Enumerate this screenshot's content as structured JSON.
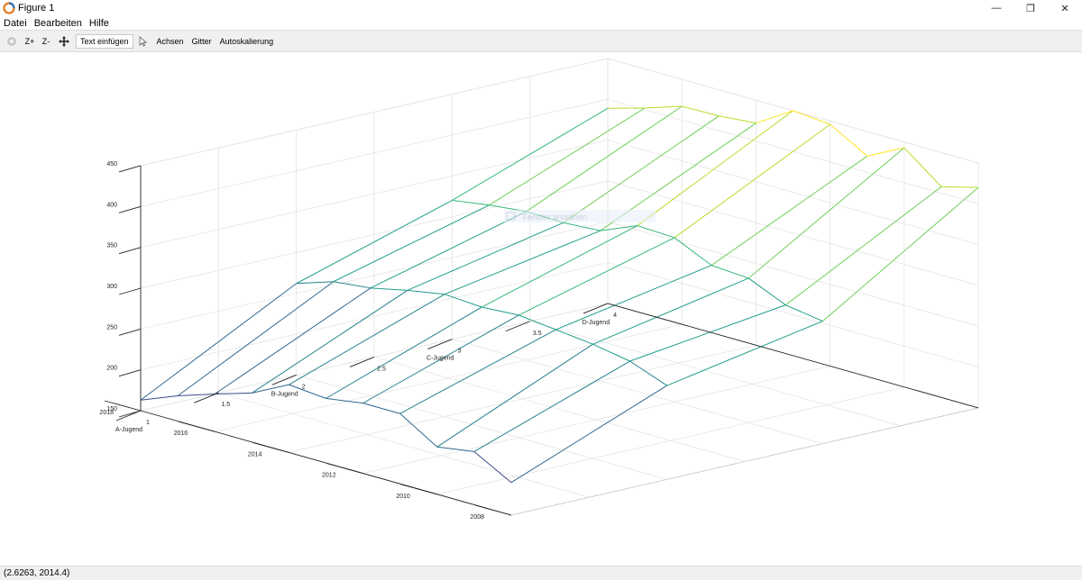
{
  "window": {
    "title": "Figure 1",
    "controls": {
      "minimize": "—",
      "restore": "❐",
      "close": "✕"
    }
  },
  "menu": {
    "items": [
      "Datei",
      "Bearbeiten",
      "Hilfe"
    ]
  },
  "toolbar": {
    "zoom_in": "Z+",
    "zoom_out": "Z-",
    "text_insert": "Text einfügen",
    "axes": "Achsen",
    "grid": "Gitter",
    "autoscale": "Autoskalierung",
    "icons": [
      "rotate-icon",
      "pan-icon",
      "select-arrow-icon"
    ]
  },
  "overlay": {
    "text": "Fenster anordnen"
  },
  "status": {
    "coords": "(2.6263, 2014.4)"
  },
  "chart_data": {
    "type": "surface-mesh",
    "title": "",
    "xlabel": "",
    "ylabel": "",
    "zlabel": "",
    "x_ticks": [
      "1",
      "1.5",
      "2",
      "2.5",
      "3",
      "3.5",
      "4"
    ],
    "x_category_labels": [
      "A-Jugend",
      "B-Jugend",
      "C-Jugend",
      "D-Jugend"
    ],
    "y_ticks": [
      "2008",
      "2010",
      "2012",
      "2014",
      "2016",
      "2018"
    ],
    "z_ticks": [
      "150",
      "200",
      "250",
      "300",
      "350",
      "400",
      "450"
    ],
    "xlim": [
      1,
      4
    ],
    "ylim": [
      2008,
      2018
    ],
    "zlim": [
      150,
      450
    ],
    "grid": true,
    "colormap": [
      "#482878",
      "#3e4a89",
      "#31688e",
      "#26828e",
      "#1f9e89",
      "#35b779",
      "#6ece58",
      "#b5de2b",
      "#fde725"
    ],
    "x": [
      1,
      2,
      3,
      4
    ],
    "y": [
      2008,
      2009,
      2010,
      2011,
      2012,
      2013,
      2014,
      2015,
      2016,
      2017,
      2018
    ],
    "z": [
      [
        190,
        265,
        300,
        420
      ],
      [
        215,
        282,
        307,
        408
      ],
      [
        208,
        290,
        327,
        443
      ],
      [
        236,
        295,
        330,
        420
      ],
      [
        236,
        300,
        351,
        446
      ],
      [
        229,
        297,
        353,
        450
      ],
      [
        233,
        300,
        334,
        422
      ],
      [
        210,
        292,
        331,
        418
      ],
      [
        196,
        282,
        332,
        417
      ],
      [
        181,
        277,
        327,
        402
      ],
      [
        163,
        262,
        320,
        389
      ]
    ]
  }
}
